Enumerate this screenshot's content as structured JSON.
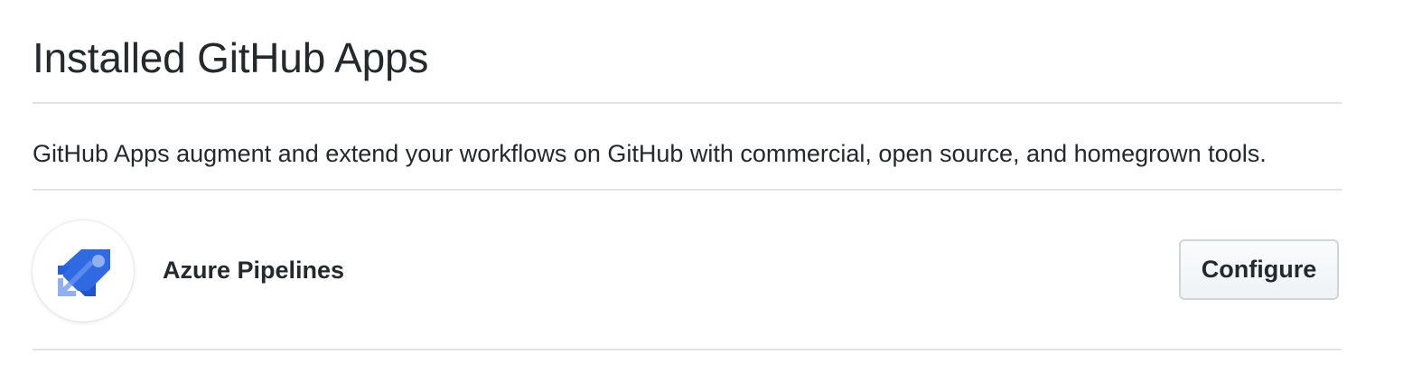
{
  "page": {
    "title": "Installed GitHub Apps",
    "description": "GitHub Apps augment and extend your workflows on GitHub with commercial, open source, and homegrown tools."
  },
  "apps": [
    {
      "name": "Azure Pipelines",
      "icon": "azure-pipelines-icon",
      "action_label": "Configure"
    }
  ],
  "colors": {
    "text": "#24292e",
    "divider": "#e1e4e8",
    "brand_blue": "#2560e0",
    "brand_light": "#91b0f2"
  }
}
